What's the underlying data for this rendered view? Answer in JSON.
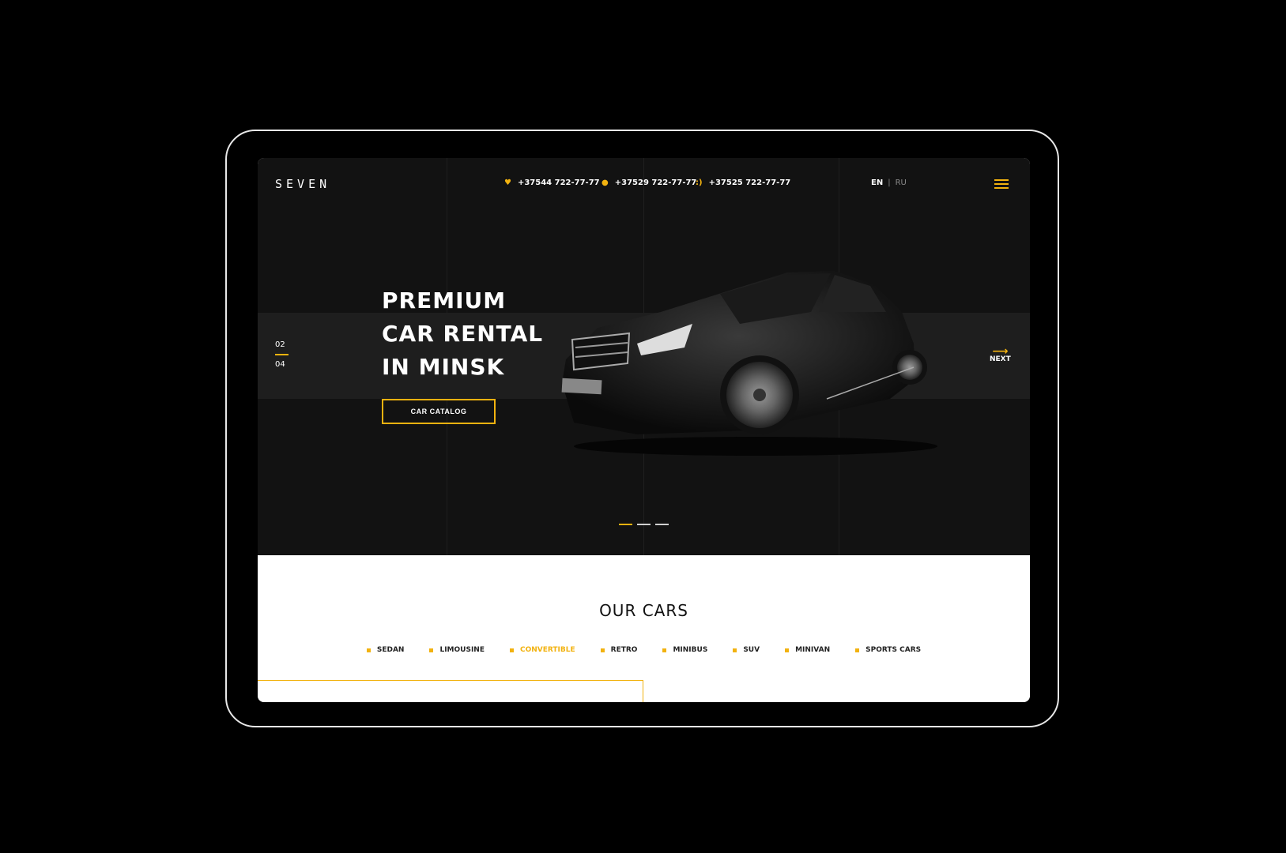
{
  "header": {
    "logo": "SEVEN",
    "phones": [
      {
        "icon": "heart-icon",
        "glyph": "♥",
        "number": "+37544 722-77-77"
      },
      {
        "icon": "drop-icon",
        "glyph": "●",
        "number": "+37529 722-77-77"
      },
      {
        "icon": "smile-icon",
        "glyph": ":)",
        "number": "+37525 722-77-77"
      }
    ],
    "lang_active": "EN",
    "lang_sep": "|",
    "lang_other": "RU"
  },
  "hero": {
    "slide_current": "02",
    "slide_total": "04",
    "title_lines": [
      "PREMIUM",
      "CAR RENTAL",
      "IN MINSK"
    ],
    "cta": "CAR CATALOG",
    "next_arrow": "⟶",
    "next_label": "NEXT",
    "slider_dots": 3,
    "active_dot": 1
  },
  "cars": {
    "heading": "OUR CARS",
    "categories": [
      "SEDAN",
      "LIMOUSINE",
      "CONVERTIBLE",
      "RETRO",
      "MINIBUS",
      "SUV",
      "MINIVAN",
      "SPORTS CARS"
    ],
    "active_category": "CONVERTIBLE"
  },
  "colors": {
    "accent": "#f2b20f",
    "hero_bg": "#121212"
  }
}
